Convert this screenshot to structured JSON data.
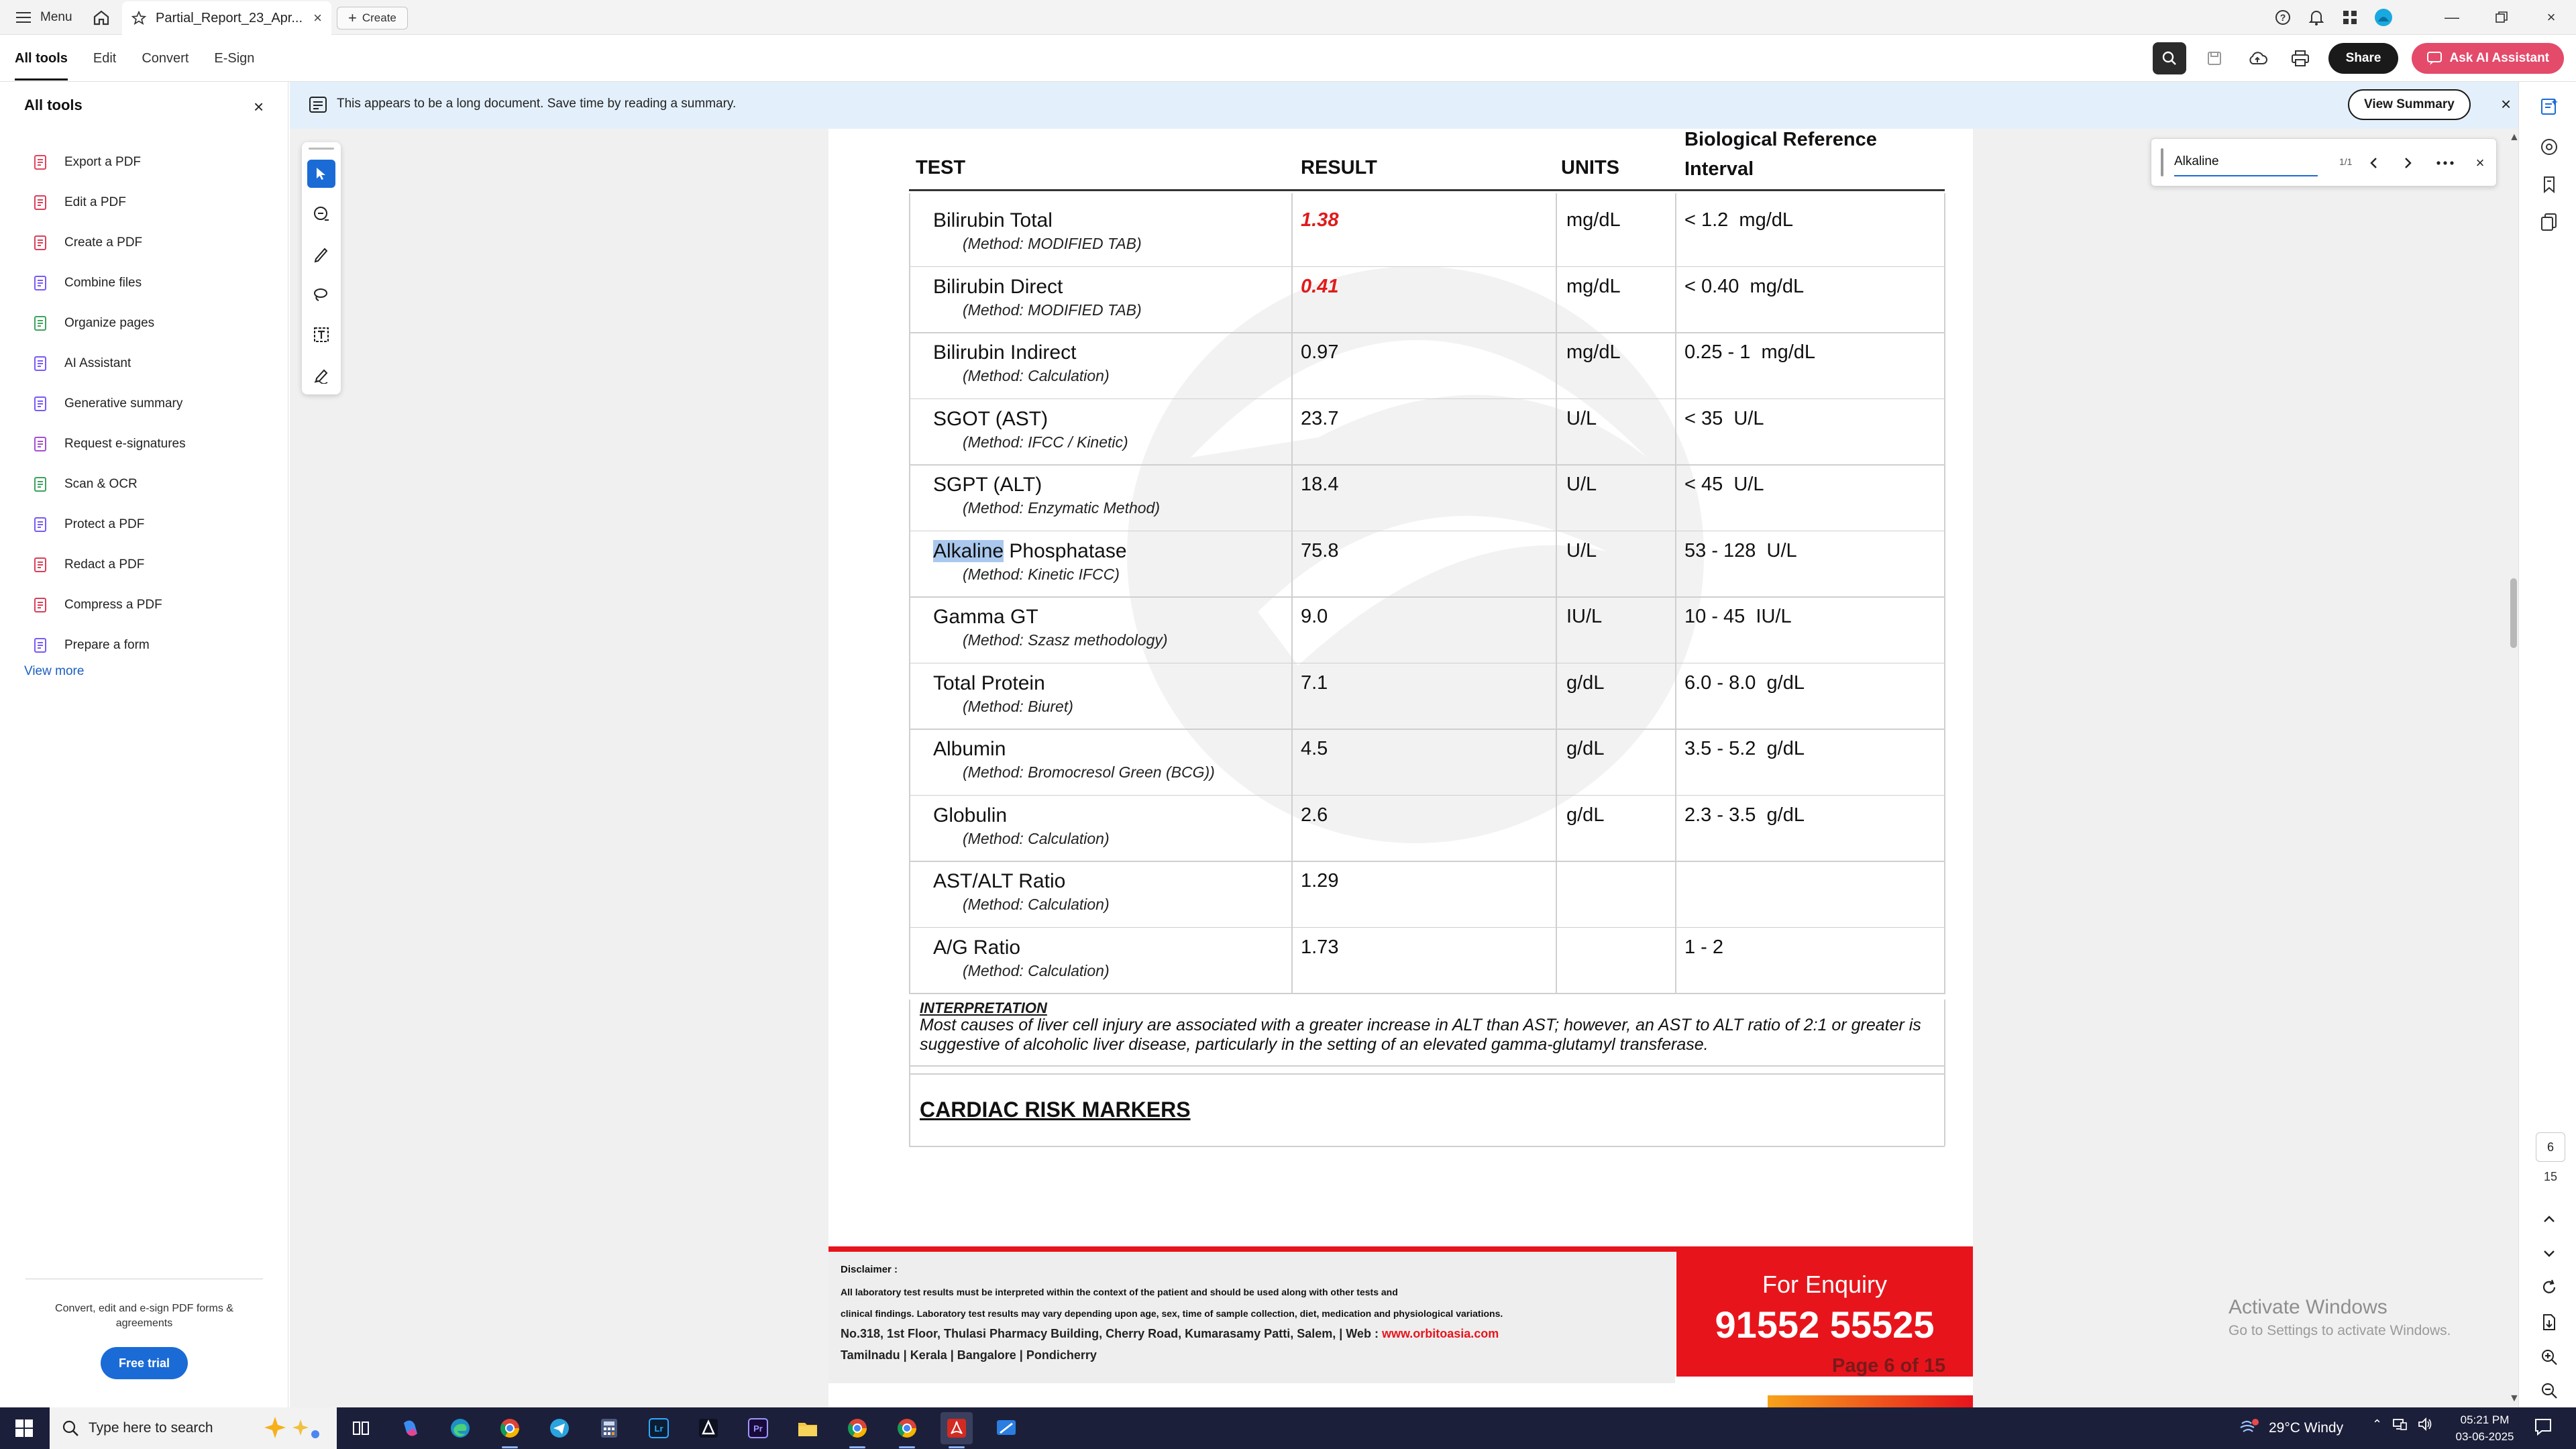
{
  "titlebar": {
    "menu_label": "Menu",
    "doc_tab_title": "Partial_Report_23_Apr...",
    "create_label": "Create"
  },
  "toolbar": {
    "tabs": [
      "All tools",
      "Edit",
      "Convert",
      "E-Sign"
    ],
    "share_label": "Share",
    "ai_label": "Ask AI Assistant"
  },
  "left_panel": {
    "title": "All tools",
    "items": [
      {
        "label": "Export a PDF",
        "icon": "export-pdf-icon",
        "color": "#e0455c"
      },
      {
        "label": "Edit a PDF",
        "icon": "edit-pdf-icon",
        "color": "#d9405a"
      },
      {
        "label": "Create a PDF",
        "icon": "create-pdf-icon",
        "color": "#d9405a"
      },
      {
        "label": "Combine files",
        "icon": "combine-files-icon",
        "color": "#7a5af5"
      },
      {
        "label": "Organize pages",
        "icon": "organize-pages-icon",
        "color": "#3da35d"
      },
      {
        "label": "AI Assistant",
        "icon": "ai-assistant-icon",
        "color": "#7a5af5"
      },
      {
        "label": "Generative summary",
        "icon": "generative-summary-icon",
        "color": "#7a5af5"
      },
      {
        "label": "Request e-signatures",
        "icon": "request-esign-icon",
        "color": "#a64fd0"
      },
      {
        "label": "Scan & OCR",
        "icon": "scan-ocr-icon",
        "color": "#3da35d"
      },
      {
        "label": "Protect a PDF",
        "icon": "protect-pdf-icon",
        "color": "#7a5af5"
      },
      {
        "label": "Redact a PDF",
        "icon": "redact-pdf-icon",
        "color": "#d9405a"
      },
      {
        "label": "Compress a PDF",
        "icon": "compress-pdf-icon",
        "color": "#d9405a"
      },
      {
        "label": "Prepare a form",
        "icon": "prepare-form-icon",
        "color": "#7a5af5"
      }
    ],
    "view_more": "View more",
    "footer_text": "Convert, edit and e-sign PDF forms & agreements",
    "free_trial": "Free trial"
  },
  "banner": {
    "text": "This appears to be a long document. Save time by reading a summary.",
    "view_summary": "View Summary"
  },
  "find": {
    "value": "Alkaline",
    "count": "1/1"
  },
  "report": {
    "headers": {
      "test": "TEST",
      "result": "RESULT",
      "units": "UNITS",
      "ref_line1": "Biological Reference",
      "ref_line2": "Interval"
    },
    "rows": [
      {
        "name": "Bilirubin Total",
        "name_rest": "",
        "method": "(Method: MODIFIED TAB)",
        "result": "1.38",
        "abnormal": true,
        "unit": "mg/dL",
        "ref": "< 1.2  mg/dL"
      },
      {
        "name": "Bilirubin Direct",
        "name_rest": "",
        "method": "(Method: MODIFIED TAB)",
        "result": "0.41",
        "abnormal": true,
        "unit": "mg/dL",
        "ref": "< 0.40  mg/dL"
      },
      {
        "name": "Bilirubin Indirect",
        "name_rest": "",
        "method": "(Method: Calculation)",
        "result": "0.97",
        "abnormal": false,
        "unit": "mg/dL",
        "ref": "0.25 - 1  mg/dL"
      },
      {
        "name": "SGOT (AST)",
        "name_rest": "",
        "method": "(Method: IFCC / Kinetic)",
        "result": "23.7",
        "abnormal": false,
        "unit": "U/L",
        "ref": "< 35  U/L"
      },
      {
        "name": "SGPT (ALT)",
        "name_rest": "",
        "method": "(Method: Enzymatic Method)",
        "result": "18.4",
        "abnormal": false,
        "unit": "U/L",
        "ref": "< 45  U/L"
      },
      {
        "name": "Alkaline",
        "name_rest": " Phosphatase",
        "method": "(Method: Kinetic IFCC)",
        "result": "75.8",
        "abnormal": false,
        "unit": "U/L",
        "ref": "53 - 128  U/L"
      },
      {
        "name": "Gamma GT",
        "name_rest": "",
        "method": "(Method: Szasz methodology)",
        "result": "9.0",
        "abnormal": false,
        "unit": "IU/L",
        "ref": "10 - 45  IU/L"
      },
      {
        "name": "Total Protein",
        "name_rest": "",
        "method": "(Method: Biuret)",
        "result": "7.1",
        "abnormal": false,
        "unit": "g/dL",
        "ref": "6.0 - 8.0  g/dL"
      },
      {
        "name": "Albumin",
        "name_rest": "",
        "method": "(Method: Bromocresol Green (BCG))",
        "result": "4.5",
        "abnormal": false,
        "unit": "g/dL",
        "ref": "3.5 - 5.2  g/dL"
      },
      {
        "name": "Globulin",
        "name_rest": "",
        "method": "(Method: Calculation)",
        "result": "2.6",
        "abnormal": false,
        "unit": "g/dL",
        "ref": "2.3 - 3.5  g/dL"
      },
      {
        "name": "AST/ALT Ratio",
        "name_rest": "",
        "method": "(Method: Calculation)",
        "result": "1.29",
        "abnormal": false,
        "unit": "",
        "ref": ""
      },
      {
        "name": "A/G Ratio",
        "name_rest": "",
        "method": "(Method: Calculation)",
        "result": "1.73",
        "abnormal": false,
        "unit": "",
        "ref": "1 - 2"
      }
    ],
    "interpretation_title": "INTERPRETATION",
    "interpretation_text": "Most causes of liver cell injury are associated with a greater increase in ALT than AST; however, an AST to ALT ratio of 2:1 or greater is suggestive of alcoholic liver disease, particularly in the setting of an elevated gamma-glutamyl transferase.",
    "next_section": "CARDIAC RISK MARKERS"
  },
  "page_footer": {
    "disclaimer_title": "Disclaimer :",
    "disclaimer_line1": "All laboratory test results must be interpreted within the context of the patient and should be used along with other tests and",
    "disclaimer_line2": "clinical findings. Laboratory test results may vary depending upon age, sex, time of sample collection, diet, medication and physiological variations.",
    "address": "No.318, 1st Floor, Thulasi Pharmacy Building, Cherry Road, Kumarasamy Patti, Salem,  |  Web : ",
    "website": "www.orbitoasia.com",
    "regions": "Tamilnadu  |  Kerala  |  Bangalore  |  Pondicherry",
    "enquiry_label": "For Enquiry",
    "enquiry_number": "91552 55525",
    "page_label": "Page 6 of 15"
  },
  "right_rail": {
    "current_page": "6",
    "total_pages": "15"
  },
  "watermark_text": {
    "title": "Activate Windows",
    "subtitle": "Go to Settings to activate Windows."
  },
  "taskbar": {
    "search_placeholder": "Type here to search",
    "weather": "29°C  Windy",
    "time": "05:21 PM",
    "date": "03-06-2025"
  }
}
